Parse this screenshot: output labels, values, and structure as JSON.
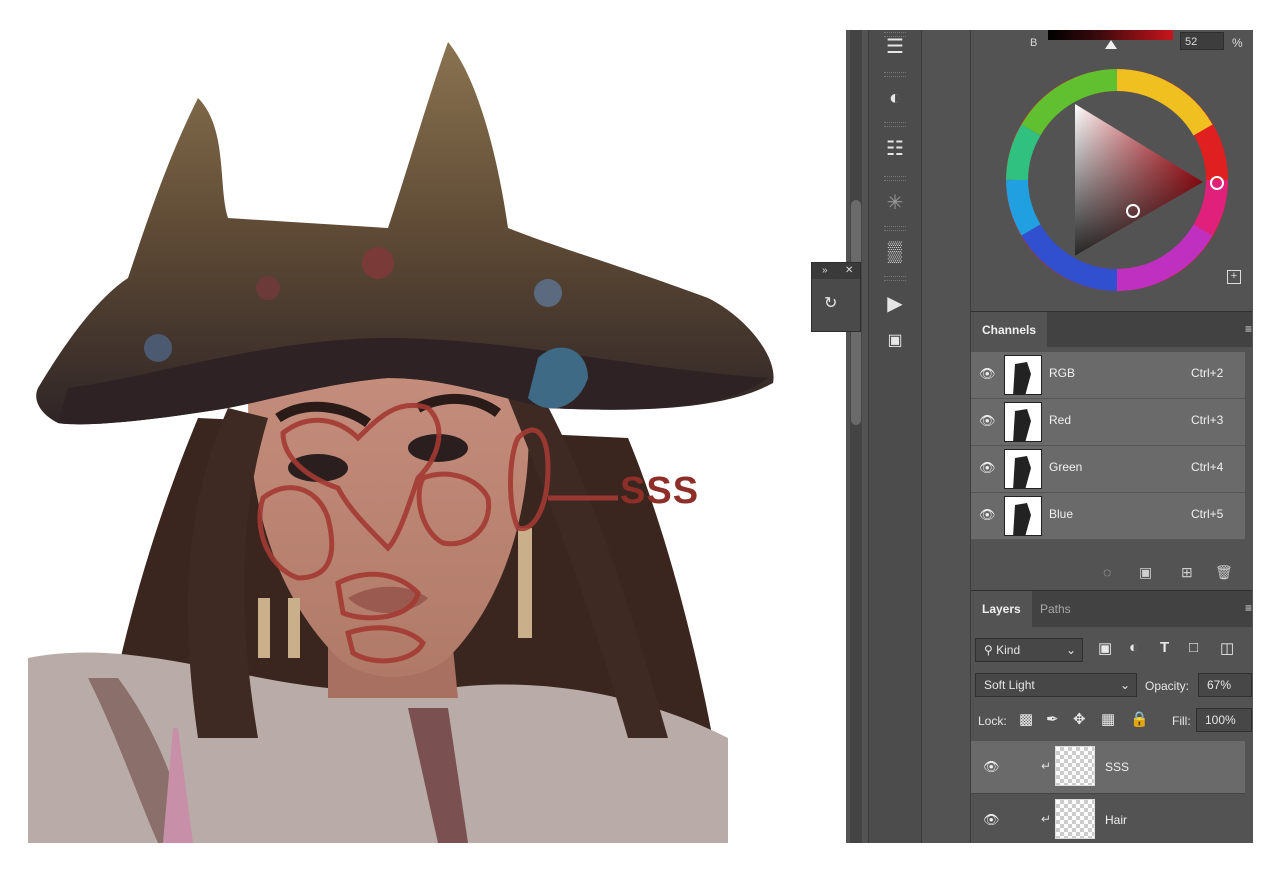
{
  "annotation": {
    "label": "SSS",
    "color": "#8e2e28"
  },
  "color_panel": {
    "channel_label": "B",
    "value": "52",
    "unit": "%"
  },
  "tools": [
    "brush-settings-icon",
    "adjust-icon",
    "sliders-icon",
    "burst-icon",
    "histogram-icon",
    "play-icon",
    "plugin-icon"
  ],
  "channels_panel": {
    "tab": "Channels",
    "rows": [
      {
        "name": "RGB",
        "shortcut": "Ctrl+2"
      },
      {
        "name": "Red",
        "shortcut": "Ctrl+3"
      },
      {
        "name": "Green",
        "shortcut": "Ctrl+4"
      },
      {
        "name": "Blue",
        "shortcut": "Ctrl+5"
      }
    ]
  },
  "layers_panel": {
    "tabs": [
      "Layers",
      "Paths"
    ],
    "filter_kind": "Kind",
    "blend_mode": "Soft Light",
    "opacity_label": "Opacity:",
    "opacity_value": "67%",
    "lock_label": "Lock:",
    "fill_label": "Fill:",
    "fill_value": "100%",
    "layers": [
      {
        "name": "SSS",
        "selected": true
      },
      {
        "name": "Hair",
        "selected": false
      }
    ]
  }
}
